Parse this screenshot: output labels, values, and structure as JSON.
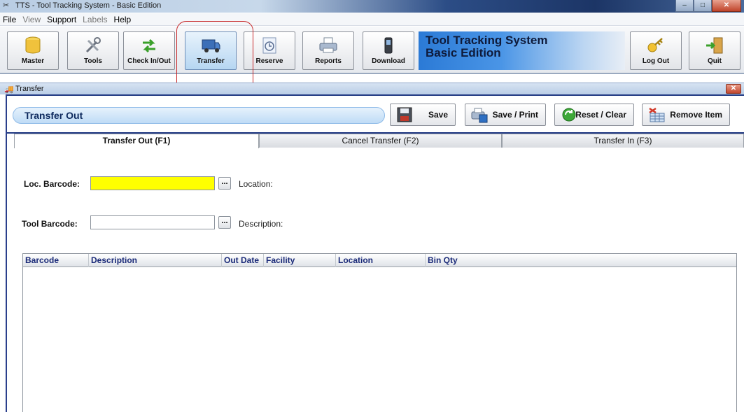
{
  "window": {
    "title": "TTS - Tool Tracking System - Basic Edition",
    "buttons": {
      "minimize": "–",
      "maximize": "□",
      "close": "✕"
    }
  },
  "menu": [
    {
      "label": "File",
      "enabled": true
    },
    {
      "label": "View",
      "enabled": false
    },
    {
      "label": "Support",
      "enabled": true
    },
    {
      "label": "Labels",
      "enabled": false
    },
    {
      "label": "Help",
      "enabled": true
    }
  ],
  "toolbar": {
    "master": "Master",
    "tools": "Tools",
    "checkinout": "Check In/Out",
    "transfer": "Transfer",
    "reserve": "Reserve",
    "reports": "Reports",
    "download": "Download",
    "logout": "Log Out",
    "quit": "Quit",
    "active": "Transfer",
    "icons": [
      "database-icon",
      "tools-icon",
      "arrows-icon",
      "truck-icon",
      "clock-icon",
      "printer-icon",
      "handheld-icon",
      "key-icon",
      "exit-door-icon"
    ]
  },
  "brand": {
    "line1": "Tool Tracking System",
    "line2": "Basic Edition"
  },
  "child": {
    "title": "Transfer",
    "close": "✕",
    "mode_title": "Transfer Out",
    "actions": {
      "save": "Save",
      "save_print": "Save / Print",
      "reset_clear": "Reset / Clear",
      "remove_item": "Remove Item"
    }
  },
  "tabs": [
    {
      "label": "Transfer Out (F1)",
      "active": true
    },
    {
      "label": "Cancel Transfer (F2)",
      "active": false
    },
    {
      "label": "Transfer In (F3)",
      "active": false
    }
  ],
  "form": {
    "loc_barcode_label": "Loc. Barcode:",
    "loc_barcode_value": "",
    "location_label": "Location:",
    "tool_barcode_label": "Tool Barcode:",
    "tool_barcode_value": "",
    "description_label": "Description:",
    "browse": "..."
  },
  "grid": {
    "columns": [
      "Barcode",
      "Description",
      "Out Date",
      "Facility",
      "Location",
      "Bin Qty"
    ],
    "rows": []
  },
  "colors": {
    "highlight": "#c8282a",
    "active_field": "#ffff00",
    "header_text": "#1a2a78"
  }
}
